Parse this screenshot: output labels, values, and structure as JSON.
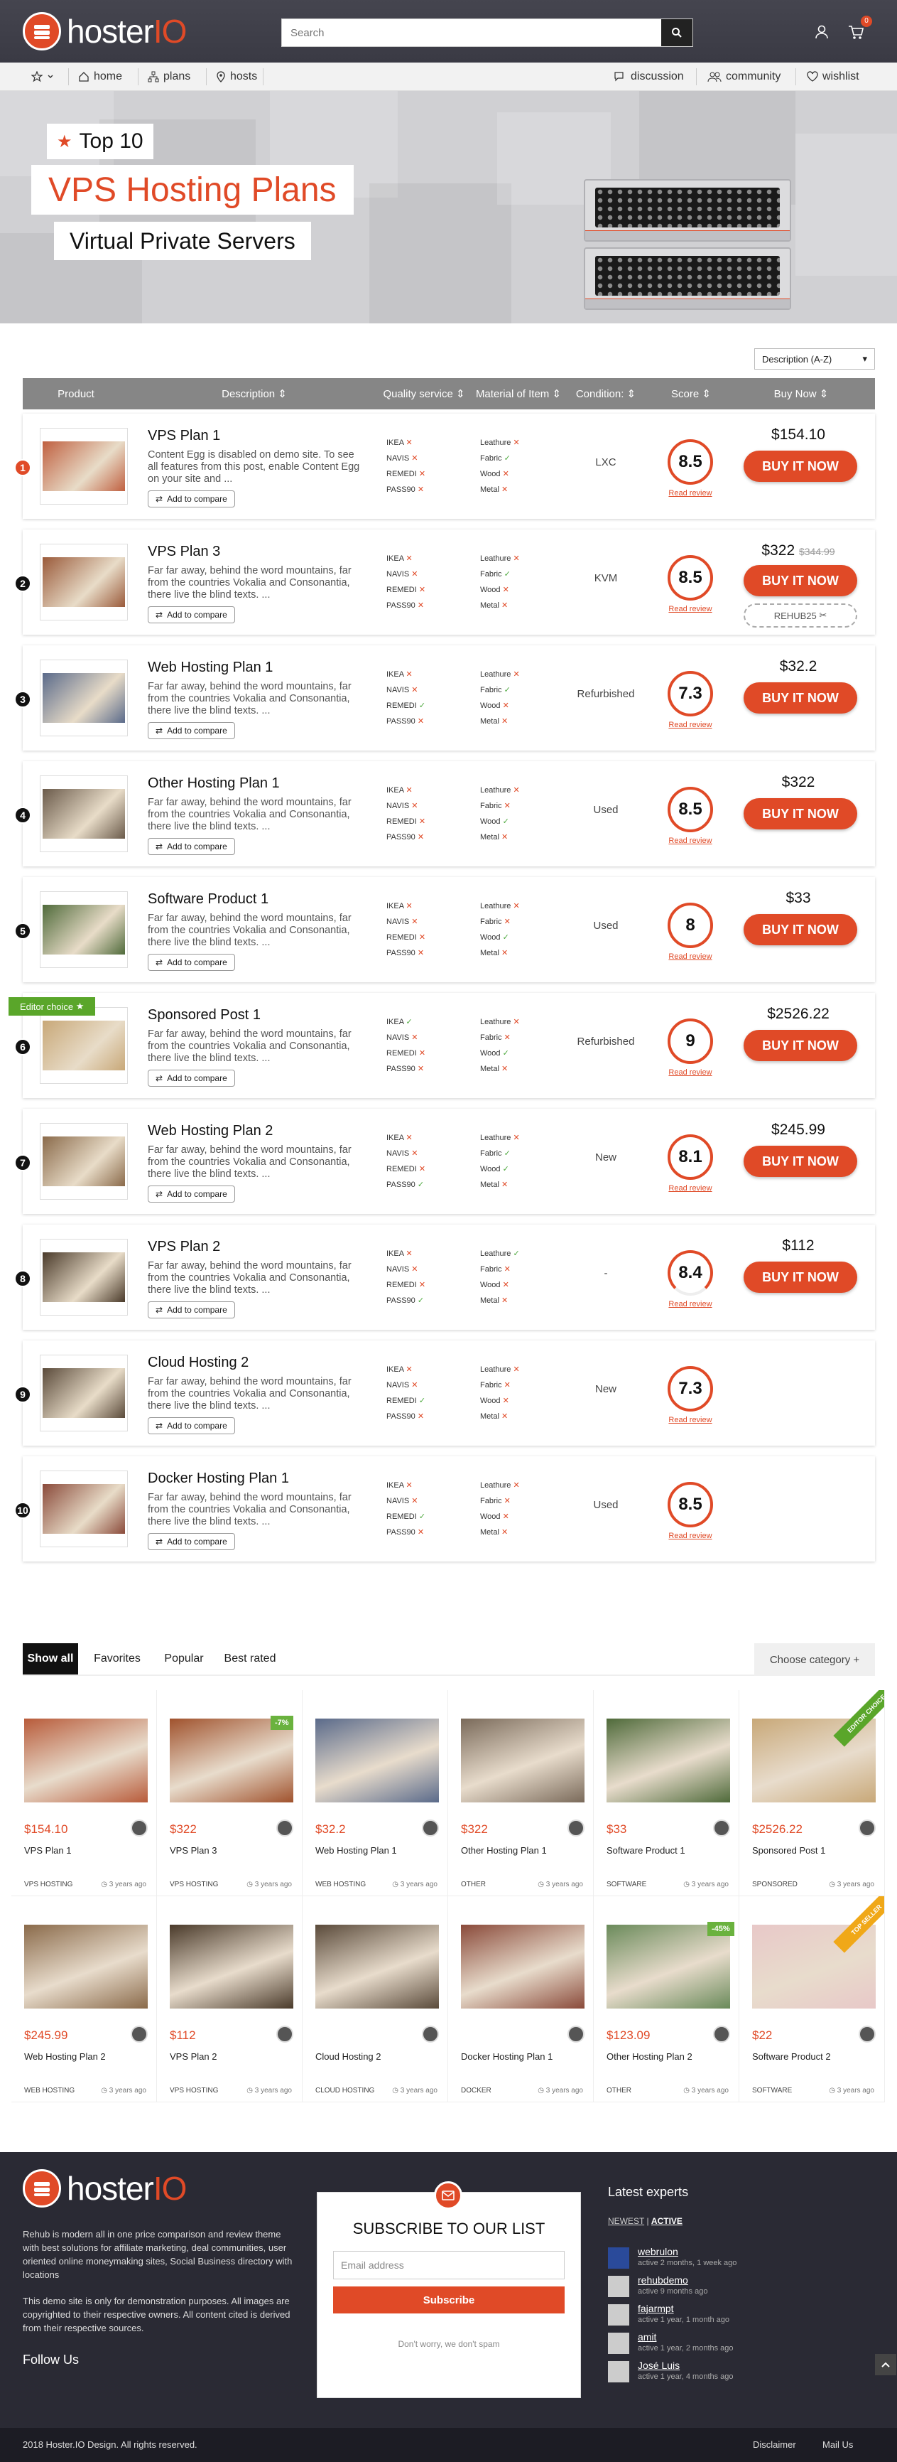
{
  "header": {
    "brand_main": "hoster",
    "brand_accent": "IO",
    "search_placeholder": "Search",
    "cart_count": "0"
  },
  "nav": {
    "home": "home",
    "plans": "plans",
    "hosts": "hosts",
    "discussion": "discussion",
    "community": "community",
    "wishlist": "wishlist"
  },
  "hero": {
    "top": "Top 10",
    "title": "VPS Hosting Plans",
    "subtitle": "Virtual Private Servers"
  },
  "sort": {
    "selected": "Description (A-Z)"
  },
  "table": {
    "headers": {
      "product": "Product",
      "description": "Description",
      "quality": "Quality service",
      "material": "Material of Item",
      "condition": "Condition:",
      "score": "Score",
      "buy": "Buy Now"
    },
    "read_review": "Read review",
    "add_compare": "Add to compare",
    "buy_label": "BUY IT NOW",
    "rows": [
      {
        "rank": "1",
        "title": "VPS Plan 1",
        "desc": "Content Egg is disabled on demo site. To see all features from this post, enable Content Egg on your site and ...",
        "condition": "LXC",
        "score": "8.5",
        "price": "$154.10",
        "old": "",
        "coupon": "",
        "q": [
          "x",
          "x",
          "x",
          "x"
        ],
        "m": [
          "x",
          "v",
          "x",
          "x"
        ]
      },
      {
        "rank": "2",
        "title": "VPS Plan 3",
        "desc": "Far far away, behind the word mountains, far from the countries Vokalia and Consonantia, there live the blind texts. ...",
        "condition": "KVM",
        "score": "8.5",
        "price": "$322",
        "old": "$344.99",
        "coupon": "REHUB25",
        "q": [
          "x",
          "x",
          "x",
          "x"
        ],
        "m": [
          "x",
          "v",
          "x",
          "x"
        ]
      },
      {
        "rank": "3",
        "title": "Web Hosting Plan 1",
        "desc": "Far far away, behind the word mountains, far from the countries Vokalia and Consonantia, there live the blind texts. ...",
        "condition": "Refurbished",
        "score": "7.3",
        "price": "$32.2",
        "old": "",
        "coupon": "",
        "q": [
          "x",
          "x",
          "v",
          "x"
        ],
        "m": [
          "x",
          "v",
          "x",
          "x"
        ]
      },
      {
        "rank": "4",
        "title": "Other Hosting Plan 1",
        "desc": "Far far away, behind the word mountains, far from the countries Vokalia and Consonantia, there live the blind texts. ...",
        "condition": "Used",
        "score": "8.5",
        "price": "$322",
        "old": "",
        "coupon": "",
        "q": [
          "x",
          "x",
          "x",
          "x"
        ],
        "m": [
          "x",
          "x",
          "v",
          "x"
        ]
      },
      {
        "rank": "5",
        "title": "Software Product 1",
        "desc": "Far far away, behind the word mountains, far from the countries Vokalia and Consonantia, there live the blind texts. ...",
        "condition": "Used",
        "score": "8",
        "price": "$33",
        "old": "",
        "coupon": "",
        "q": [
          "x",
          "x",
          "x",
          "x"
        ],
        "m": [
          "x",
          "x",
          "v",
          "x"
        ]
      },
      {
        "rank": "6",
        "title": "Sponsored Post 1",
        "desc": "Far far away, behind the word mountains, far from the countries Vokalia and Consonantia, there live the blind texts. ...",
        "condition": "Refurbished",
        "score": "9",
        "price": "$2526.22",
        "old": "",
        "coupon": "",
        "q": [
          "v",
          "x",
          "x",
          "x"
        ],
        "m": [
          "x",
          "x",
          "v",
          "x"
        ]
      },
      {
        "rank": "7",
        "title": "Web Hosting Plan 2",
        "desc": "Far far away, behind the word mountains, far from the countries Vokalia and Consonantia, there live the blind texts. ...",
        "condition": "New",
        "score": "8.1",
        "price": "$245.99",
        "old": "",
        "coupon": "",
        "q": [
          "x",
          "x",
          "x",
          "v"
        ],
        "m": [
          "x",
          "v",
          "v",
          "x"
        ]
      },
      {
        "rank": "8",
        "title": "VPS Plan 2",
        "desc": "Far far away, behind the word mountains, far from the countries Vokalia and Consonantia, there live the blind texts. ...",
        "condition": "-",
        "score": "8.4",
        "price": "$112",
        "old": "",
        "coupon": "",
        "q": [
          "x",
          "x",
          "x",
          "v"
        ],
        "m": [
          "v",
          "x",
          "x",
          "x"
        ]
      },
      {
        "rank": "9",
        "title": "Cloud Hosting 2",
        "desc": "Far far away, behind the word mountains, far from the countries Vokalia and Consonantia, there live the blind texts. ...",
        "condition": "New",
        "score": "7.3",
        "price": "",
        "old": "",
        "coupon": "",
        "q": [
          "x",
          "x",
          "v",
          "x"
        ],
        "m": [
          "x",
          "x",
          "x",
          "x"
        ]
      },
      {
        "rank": "10",
        "title": "Docker Hosting Plan 1",
        "desc": "Far far away, behind the word mountains, far from the countries Vokalia and Consonantia, there live the blind texts. ...",
        "condition": "Used",
        "score": "8.5",
        "price": "",
        "old": "",
        "coupon": "",
        "q": [
          "x",
          "x",
          "v",
          "x"
        ],
        "m": [
          "x",
          "x",
          "x",
          "x"
        ]
      }
    ],
    "q_labels": [
      "IKEA",
      "NAVIS",
      "REMEDI",
      "PASS90"
    ],
    "m_labels": [
      "Leathure",
      "Fabric",
      "Wood",
      "Metal"
    ],
    "editor_choice": "Editor choice"
  },
  "tabs": {
    "all": "Show all",
    "favorites": "Favorites",
    "popular": "Popular",
    "best": "Best rated",
    "category": "Choose category +"
  },
  "grid": [
    {
      "price": "$154.10",
      "old": "",
      "title": "VPS Plan 1",
      "cat": "VPS HOSTING",
      "date": "3 years ago",
      "img": "#b85b3a"
    },
    {
      "price": "$322",
      "old": "",
      "title": "VPS Plan 3",
      "cat": "VPS HOSTING",
      "date": "3 years ago",
      "img": "#a0522d",
      "pct": "-7%"
    },
    {
      "price": "$32.2",
      "old": "",
      "title": "Web Hosting Plan 1",
      "cat": "WEB HOSTING",
      "date": "3 years ago",
      "img": "#5a6a8a"
    },
    {
      "price": "$322",
      "old": "",
      "title": "Other Hosting Plan 1",
      "cat": "OTHER",
      "date": "3 years ago",
      "img": "#7a6a5a"
    },
    {
      "price": "$33",
      "old": "",
      "title": "Software Product 1",
      "cat": "SOFTWARE",
      "date": "3 years ago",
      "img": "#4f6a3a"
    },
    {
      "price": "$2526.22",
      "old": "",
      "title": "Sponsored Post 1",
      "cat": "SPONSORED",
      "date": "3 years ago",
      "img": "#c8a878",
      "ribbon": "EDITOR CHOICE",
      "ribbon_color": "#5aa62a"
    },
    {
      "price": "$245.99",
      "old": "",
      "title": "Web Hosting Plan 2",
      "cat": "WEB HOSTING",
      "date": "3 years ago",
      "img": "#8a6a4a"
    },
    {
      "price": "$112",
      "old": "",
      "title": "VPS Plan 2",
      "cat": "VPS HOSTING",
      "date": "3 years ago",
      "img": "#4a3a2a"
    },
    {
      "price": "",
      "old": "",
      "title": "Cloud Hosting 2",
      "cat": "CLOUD HOSTING",
      "date": "3 years ago",
      "img": "#5a4a3a"
    },
    {
      "price": "",
      "old": "",
      "title": "Docker Hosting Plan 1",
      "cat": "DOCKER",
      "date": "3 years ago",
      "img": "#8a4a3a"
    },
    {
      "price": "$123.09",
      "old": "",
      "title": "Other Hosting Plan 2",
      "cat": "OTHER",
      "date": "3 years ago",
      "img": "#6a8a5a",
      "pct": "-45%"
    },
    {
      "price": "$22",
      "old": "",
      "title": "Software Product 2",
      "cat": "SOFTWARE",
      "date": "3 years ago",
      "img": "#e8c8c8",
      "ribbon": "TOP SELLER",
      "ribbon_color": "#f0a818"
    }
  ],
  "footer": {
    "brand_main": "hoster",
    "brand_accent": "IO",
    "desc1": "Rehub is modern all in one price comparison and review theme with best solutions for affiliate marketing, deal communities, user oriented online moneymaking sites, Social Business directory with locations",
    "desc2": "This demo site is only for demonstration purposes. All images are copyrighted to their respective owners. All content cited is derived from their respective sources.",
    "follow": "Follow Us",
    "sub_title": "SUBSCRIBE TO OUR LIST",
    "sub_placeholder": "Email address",
    "sub_btn": "Subscribe",
    "sub_note": "Don't worry, we don't spam",
    "experts_title": "Latest experts",
    "tab_newest": "NEWEST",
    "tab_active": "ACTIVE",
    "experts": [
      {
        "name": "webrulon",
        "meta": "active 2 months, 1 week ago"
      },
      {
        "name": "rehubdemo",
        "meta": "active 9 months ago"
      },
      {
        "name": "fajarmpt",
        "meta": "active 1 year, 1 month ago"
      },
      {
        "name": "amit",
        "meta": "active 1 year, 2 months ago"
      },
      {
        "name": "José Luis",
        "meta": "active 1 year, 4 months ago"
      }
    ],
    "copyright": "2018 Hoster.IO Design. All rights reserved.",
    "disclaimer": "Disclaimer",
    "mailus": "Mail Us"
  }
}
